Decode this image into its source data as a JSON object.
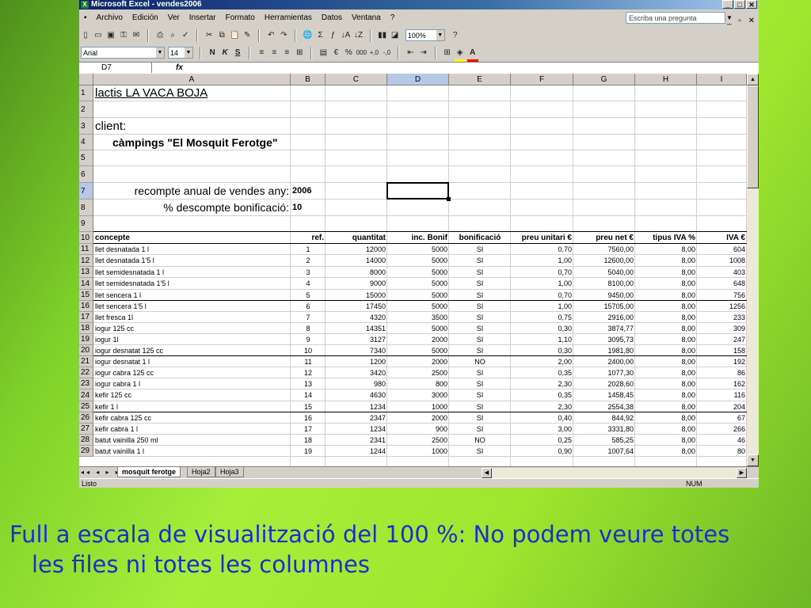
{
  "window": {
    "title": "Microsoft Excel - vendes2006"
  },
  "menu": {
    "items": [
      "Archivo",
      "Edición",
      "Ver",
      "Insertar",
      "Formato",
      "Herramientas",
      "Datos",
      "Ventana",
      "?"
    ],
    "ask_placeholder": "Escriba una pregunta"
  },
  "toolbar": {
    "zoom": "100%",
    "font_name": "Arial",
    "font_size": "14",
    "bold": "N",
    "italic": "K",
    "underline": "S",
    "euro": "€",
    "percent": "%",
    "thousands": "000",
    "sum": "Σ"
  },
  "formula_bar": {
    "name_box": "D7",
    "fx": "fx"
  },
  "grid": {
    "columns": [
      "A",
      "B",
      "C",
      "D",
      "E",
      "F",
      "G",
      "H",
      "I"
    ],
    "rows": [
      "1",
      "2",
      "3",
      "4",
      "5",
      "6",
      "7",
      "8",
      "9",
      "10",
      "11",
      "12",
      "13",
      "14",
      "15",
      "16",
      "17",
      "18",
      "19",
      "20",
      "21",
      "22",
      "23",
      "24",
      "25",
      "26",
      "27",
      "28",
      "29",
      "30"
    ],
    "selected_cell": "D7",
    "title": "lactis LA VACA BOJA",
    "client_label": "client:",
    "client_name": "càmpings \"El Mosquit Ferotge\"",
    "year_label": "recompte anual de vendes any:",
    "year_value": "2006",
    "discount_label": "% descompte bonificació:",
    "discount_value": "10",
    "headers": [
      "concepte",
      "ref.",
      "quantitat",
      "inc. Bonif",
      "bonificació",
      "preu unitari €",
      "preu net €",
      "tipus IVA %",
      "IVA €"
    ],
    "data": [
      [
        "llet desnatada 1 l",
        "1",
        "12000",
        "5000",
        "SI",
        "0,70",
        "7560,00",
        "8,00",
        "604"
      ],
      [
        "llet desnatada 1'5 l",
        "2",
        "14000",
        "5000",
        "SI",
        "1,00",
        "12600,00",
        "8,00",
        "1008"
      ],
      [
        "llet semidesnatada 1 l",
        "3",
        "8000",
        "5000",
        "SI",
        "0,70",
        "5040,00",
        "8,00",
        "403"
      ],
      [
        "llet semidesnatada 1'5 l",
        "4",
        "9000",
        "5000",
        "SI",
        "1,00",
        "8100,00",
        "8,00",
        "648"
      ],
      [
        "llet sencera 1 l",
        "5",
        "15000",
        "5000",
        "SI",
        "0,70",
        "9450,00",
        "8,00",
        "756"
      ],
      [
        "llet sencera 1'5 l",
        "6",
        "17450",
        "5000",
        "SI",
        "1,00",
        "15705,00",
        "8,00",
        "1256"
      ],
      [
        "llet fresca 1l",
        "7",
        "4320",
        "3500",
        "SI",
        "0,75",
        "2916,00",
        "8,00",
        "233"
      ],
      [
        "iogur 125 cc",
        "8",
        "14351",
        "5000",
        "SI",
        "0,30",
        "3874,77",
        "8,00",
        "309"
      ],
      [
        "iogur 1l",
        "9",
        "3127",
        "2000",
        "SI",
        "1,10",
        "3095,73",
        "8,00",
        "247"
      ],
      [
        "iogur desnatat 125 cc",
        "10",
        "7340",
        "5000",
        "SI",
        "0,30",
        "1981,80",
        "8,00",
        "158"
      ],
      [
        "iogur desnatat 1 l",
        "11",
        "1200",
        "2000",
        "NO",
        "2,00",
        "2400,00",
        "8,00",
        "192"
      ],
      [
        "iogur cabra 125 cc",
        "12",
        "3420",
        "2500",
        "SI",
        "0,35",
        "1077,30",
        "8,00",
        "86"
      ],
      [
        "iogur cabra 1 l",
        "13",
        "980",
        "800",
        "SI",
        "2,30",
        "2028,60",
        "8,00",
        "162"
      ],
      [
        "kefir 125 cc",
        "14",
        "4630",
        "3000",
        "SI",
        "0,35",
        "1458,45",
        "8,00",
        "116"
      ],
      [
        "kefir 1 l",
        "15",
        "1234",
        "1000",
        "SI",
        "2,30",
        "2554,38",
        "8,00",
        "204"
      ],
      [
        "kefir cabra 125 cc",
        "16",
        "2347",
        "2000",
        "SI",
        "0,40",
        "844,92",
        "8,00",
        "67"
      ],
      [
        "kefir cabra 1 l",
        "17",
        "1234",
        "900",
        "SI",
        "3,00",
        "3331,80",
        "8,00",
        "266"
      ],
      [
        "batut vainilla 250 ml",
        "18",
        "2341",
        "2500",
        "NO",
        "0,25",
        "585,25",
        "8,00",
        "46"
      ],
      [
        "batut vainilla 1 l",
        "19",
        "1244",
        "1000",
        "SI",
        "0,90",
        "1007,64",
        "8,00",
        "80"
      ]
    ]
  },
  "sheets": {
    "tabs": [
      "mosquit ferotge",
      "Hoja2",
      "Hoja3"
    ],
    "active": "mosquit ferotge"
  },
  "status": {
    "left": "Listo",
    "num": "NUM"
  },
  "caption": {
    "line1": "Full a escala de visualització del 100 %: No podem veure totes",
    "line2": "les files ni totes les columnes"
  }
}
